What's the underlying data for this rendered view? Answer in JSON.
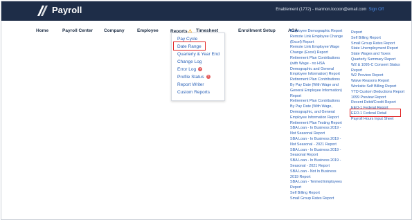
{
  "app": {
    "title": "Payroll",
    "user_info": "Enablement (1772) - marmon.locoon@email.com",
    "sign_off": "Sign Off"
  },
  "nav": {
    "items": [
      "Home",
      "Payroll Center",
      "Company",
      "Employee",
      "Reports",
      "Timesheet",
      "Enrollment Setup",
      "ACA"
    ],
    "reports_warning_icon": "warning-icon"
  },
  "dropdown": {
    "items": [
      "Pay Cycle",
      "Date Range",
      "Quarterly & Year End",
      "Change Log",
      "Error Log",
      "Profile Status",
      "Report Writer",
      "Custom Reports"
    ],
    "error_badge": "?",
    "status_badge": "?"
  },
  "reports_col2": [
    "Employee Demographic Report",
    "Remote Link Employee Change",
    "(Excel) Report",
    "Remote Link Employee Wage",
    "Change (Excel) Report",
    "Retirement Plan Contributions",
    "(with Wage - no HSA",
    "Demographic and General",
    "Employee Information) Report",
    "Retirement Plan Contributions",
    "By Pay Date (With Wage and",
    "General Employee Information)",
    "Report",
    "Retirement Plan Contributions",
    "By Pay Date (With Wage,",
    "Demographic, and General",
    "Employee Information Report",
    "Retirement Plan Testing Report",
    "SBA Loan - In Business 2019 -",
    "Not Seasonal Report",
    "SBA Loan - In Business 2019 -",
    "Not Seasonal - 2021 Report",
    "SBA Loan - In Business 2019 -",
    "Seasonal Report",
    "SBA Loan - In Business 2019 -",
    "Seasonal - 2021 Report",
    "SBA Loan - Not In Business",
    "2019 Report",
    "SBA Loan - Termed Employees",
    "Report",
    "Self Billing Report",
    "Small Group Rates Report"
  ],
  "reports_col3": [
    "Report",
    "Self Billing Report",
    "Small Group Rates Report",
    "State Unemployment Report",
    "State Wages and Taxes",
    "Quarterly Summary Report",
    "W2 & 1095-C Consent Status",
    "Report",
    "W2 Preview Report",
    "Waive Reasons Report",
    "Worksite Self Billing Report",
    "YTD Custom Deductions Report",
    "1099 Preview Report",
    "Recent Debit/Credit Report",
    "EEO-1 Federal Report",
    "EEO-1 Federal Detail",
    "Payroll Hours Input Sheet"
  ]
}
